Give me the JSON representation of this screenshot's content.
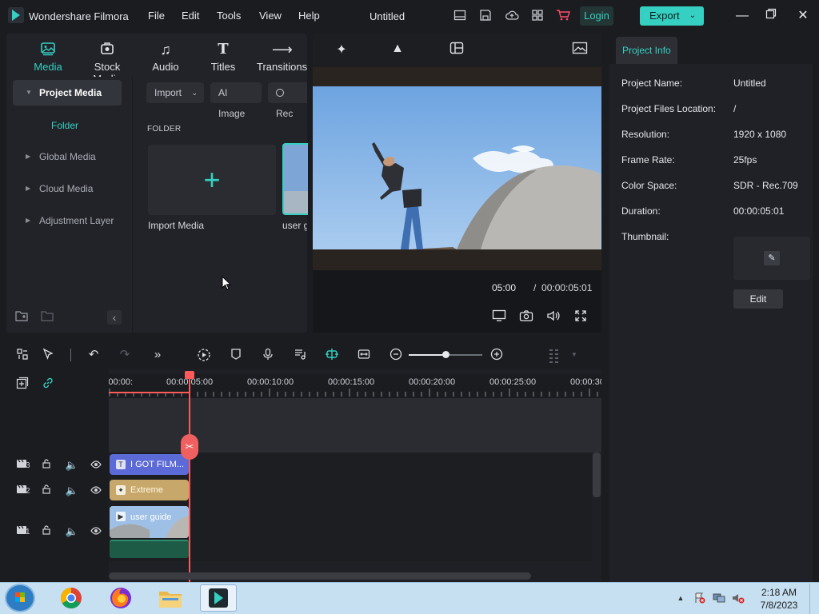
{
  "app": {
    "name": "Wondershare Filmora",
    "project_title": "Untitled",
    "menu": [
      "File",
      "Edit",
      "Tools",
      "View",
      "Help"
    ],
    "login": "Login",
    "export": "Export"
  },
  "media_tabs": [
    {
      "label": "Media",
      "icon": "media-icon",
      "active": true
    },
    {
      "label": "Stock Media",
      "icon": "stock-media-icon"
    },
    {
      "label": "Audio",
      "icon": "music-note-icon"
    },
    {
      "label": "Titles",
      "icon": "text-t-icon"
    },
    {
      "label": "Transitions",
      "icon": "transition-icon"
    }
  ],
  "sidebar": {
    "items": [
      {
        "label": "Project Media",
        "active": true
      },
      {
        "label": "Folder"
      },
      {
        "label": "Global Media"
      },
      {
        "label": "Cloud Media"
      },
      {
        "label": "Adjustment Layer"
      }
    ]
  },
  "media_toolbar": {
    "import": "Import",
    "ai_image": "AI Image",
    "record": "Rec"
  },
  "media_content": {
    "folder_header": "FOLDER",
    "tiles": [
      {
        "label": "Import Media"
      },
      {
        "label": "user g"
      }
    ]
  },
  "preview": {
    "current_time": "05:00",
    "separator": "/",
    "total_time": "00:00:05:01"
  },
  "project_info": {
    "tab": "Project Info",
    "fields": [
      {
        "key": "Project Name:",
        "value": "Untitled"
      },
      {
        "key": "Project Files Location:",
        "value": "/"
      },
      {
        "key": "Resolution:",
        "value": "1920 x 1080"
      },
      {
        "key": "Frame Rate:",
        "value": "25fps"
      },
      {
        "key": "Color Space:",
        "value": "SDR - Rec.709"
      },
      {
        "key": "Duration:",
        "value": "00:00:05:01"
      },
      {
        "key": "Thumbnail:",
        "value": ""
      }
    ],
    "edit": "Edit"
  },
  "timeline": {
    "ruler": [
      ":00:00",
      "00:00:05:00",
      "00:00:10:00",
      "00:00:15:00",
      "00:00:20:00",
      "00:00:25:00",
      "00:00:30"
    ],
    "tracks": [
      {
        "number": "3",
        "clip": "I GOT FILM...",
        "kind": "title"
      },
      {
        "number": "2",
        "clip": "Extreme",
        "kind": "effect"
      },
      {
        "number": "1",
        "clip": "user guide",
        "kind": "video"
      }
    ]
  },
  "taskbar": {
    "time": "2:18 AM",
    "date": "7/8/2023"
  },
  "colors": {
    "accent": "#35d0c1",
    "playhead": "#ff5a5a",
    "title_clip": "#5b6ad6",
    "effect_clip": "#c8a86a"
  }
}
